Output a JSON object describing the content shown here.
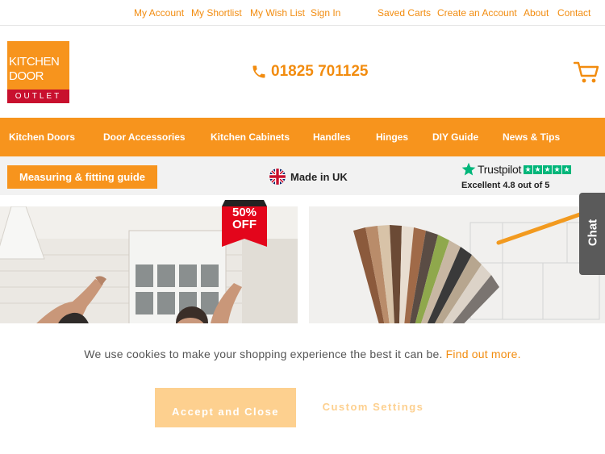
{
  "topbar": {
    "links": [
      "My Account",
      "My Shortlist",
      "My Wish List",
      "Sign In",
      "Saved Carts",
      "Create an Account",
      "About",
      "Contact"
    ]
  },
  "header": {
    "logo": {
      "line1": "KITCHEN",
      "line2": "DOOR",
      "line3": "OUTLET"
    },
    "phone": "01825 701125",
    "phone_icon": "phone-icon",
    "cart_icon": "cart-icon"
  },
  "nav": {
    "items": [
      "Kitchen Doors",
      "Door Accessories",
      "Kitchen Cabinets",
      "Handles",
      "Hinges",
      "DIY Guide",
      "News & Tips"
    ]
  },
  "subbar": {
    "measure_button": "Measuring & fitting guide",
    "made_in": "Made in UK",
    "trustpilot": {
      "name": "Trustpilot",
      "rating_text": "Excellent 4.8 out of 5",
      "stars": 5
    }
  },
  "promo": {
    "badge_line1": "50%",
    "badge_line2": "OFF"
  },
  "chat": {
    "label": "Chat"
  },
  "cookie": {
    "message": "We use cookies to make your shopping experience the best it can be.",
    "link": "Find out more.",
    "accept": "Accept and Close",
    "custom": "Custom Settings"
  },
  "colors": {
    "accent": "#f7941d",
    "link": "#f28c0f",
    "logo_red": "#c8102e",
    "trustpilot_green": "#00b67a",
    "ribbon_red": "#e3051b"
  }
}
